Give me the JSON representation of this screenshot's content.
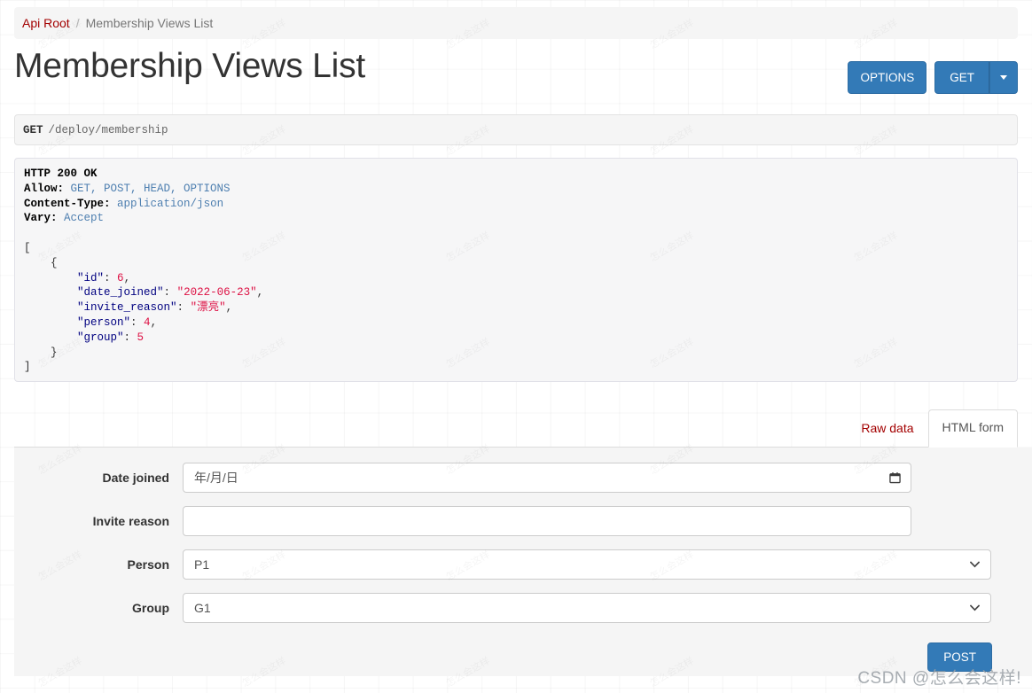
{
  "breadcrumb": {
    "root_label": "Api Root",
    "separator": "/",
    "current_label": "Membership Views List"
  },
  "header": {
    "title": "Membership Views List",
    "options_button": "OPTIONS",
    "get_button": "GET",
    "caret_icon": "caret-down-icon"
  },
  "request": {
    "method": "GET",
    "path": "/deploy/membership"
  },
  "response": {
    "status_line": "HTTP 200 OK",
    "headers": [
      {
        "name": "Allow:",
        "value": "GET, POST, HEAD, OPTIONS"
      },
      {
        "name": "Content-Type:",
        "value": "application/json"
      },
      {
        "name": "Vary:",
        "value": "Accept"
      }
    ],
    "body": {
      "open_bracket": "[",
      "open_brace": "{",
      "fields": [
        {
          "key": "\"id\"",
          "sep": ": ",
          "value": "6",
          "type": "num",
          "comma": ","
        },
        {
          "key": "\"date_joined\"",
          "sep": ": ",
          "value": "\"2022-06-23\"",
          "type": "str",
          "comma": ","
        },
        {
          "key": "\"invite_reason\"",
          "sep": ": ",
          "value": "\"漂亮\"",
          "type": "str",
          "comma": ","
        },
        {
          "key": "\"person\"",
          "sep": ": ",
          "value": "4",
          "type": "num",
          "comma": ","
        },
        {
          "key": "\"group\"",
          "sep": ": ",
          "value": "5",
          "type": "num",
          "comma": ""
        }
      ],
      "close_brace": "}",
      "close_bracket": "]"
    }
  },
  "tabs": [
    {
      "label": "Raw data",
      "active": false
    },
    {
      "label": "HTML form",
      "active": true
    }
  ],
  "form": {
    "fields": [
      {
        "label": "Date joined",
        "type": "date",
        "value": "",
        "placeholder": "年/月/日",
        "icon": "calendar-icon"
      },
      {
        "label": "Invite reason",
        "type": "text",
        "value": "",
        "placeholder": ""
      },
      {
        "label": "Person",
        "type": "select",
        "value": "P1",
        "options": [
          "P1"
        ],
        "icon": "chevron-down-icon"
      },
      {
        "label": "Group",
        "type": "select",
        "value": "G1",
        "options": [
          "G1"
        ],
        "icon": "chevron-down-icon"
      }
    ],
    "submit_label": "POST"
  },
  "watermark": {
    "text": "CSDN @怎么会这样!",
    "tile_text": "怎么会这样"
  },
  "colors": {
    "primary_button": "#337ab7",
    "link_red": "#a30000",
    "json_key": "#000080",
    "json_value": "#d14",
    "header_value": "#4e7fb0",
    "panel_bg": "#f5f5f5"
  }
}
